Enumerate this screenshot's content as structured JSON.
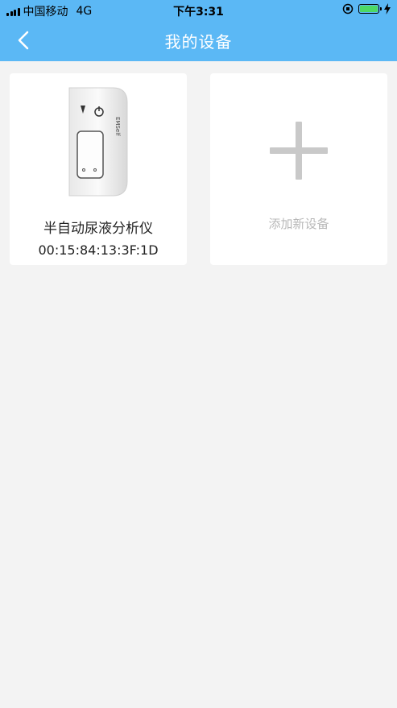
{
  "status_bar": {
    "carrier": "中国移动",
    "network": "4G",
    "time": "下午3:31"
  },
  "header": {
    "title": "我的设备",
    "back_icon": "chevron-left-icon"
  },
  "devices": [
    {
      "name": "半自动尿液分析仪",
      "mac": "00:15:84:13:3F:1D",
      "brand_mark": "EMSelf"
    }
  ],
  "add_card": {
    "label": "添加新设备",
    "icon": "plus-icon"
  },
  "colors": {
    "header_bg": "#5bb8f5",
    "page_bg": "#f3f3f3",
    "card_bg": "#ffffff",
    "battery": "#4cd964"
  }
}
